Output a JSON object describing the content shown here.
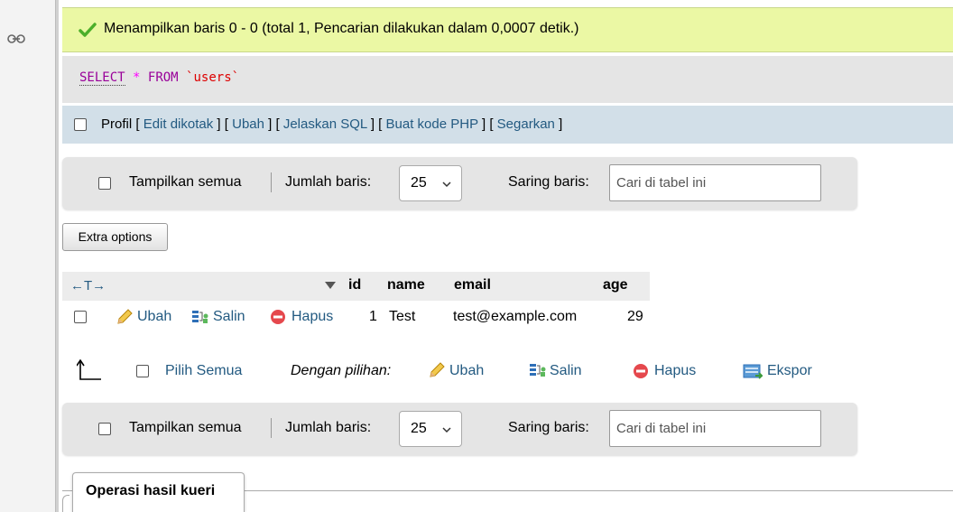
{
  "success": {
    "message": "Menampilkan baris 0 - 0 (total 1, Pencarian dilakukan dalam 0,0007 detik.)"
  },
  "sql": {
    "select": "SELECT",
    "star": "*",
    "from": "FROM",
    "table": "`users`"
  },
  "profile_bar": {
    "label": "Profil",
    "links": [
      "Edit dikotak",
      "Ubah",
      "Jelaskan SQL",
      "Buat kode PHP",
      "Segarkan"
    ]
  },
  "navigation": {
    "show_all": "Tampilkan semua",
    "rows_label": "Jumlah baris:",
    "rows_value": "25",
    "filter_label": "Saring baris:",
    "filter_placeholder": "Cari di tabel ini"
  },
  "extra_options": "Extra options",
  "table": {
    "arrows": "←T→",
    "columns": [
      "id",
      "name",
      "email",
      "age"
    ],
    "row_actions": {
      "edit": "Ubah",
      "copy": "Salin",
      "delete": "Hapus"
    },
    "rows": [
      {
        "id": "1",
        "name": "Test",
        "email": "test@example.com",
        "age": "29"
      }
    ]
  },
  "bulk": {
    "select_all": "Pilih Semua",
    "with_selected": "Dengan pilihan:",
    "edit": "Ubah",
    "copy": "Salin",
    "delete": "Hapus",
    "export": "Ekspor"
  },
  "operations_tab": "Operasi hasil kueri",
  "colors": {
    "success_bg": "#ebf8a4",
    "link": "#235a81",
    "sql_keyword": "#990099",
    "sql_table": "#dd0000",
    "profile_bg": "#d2dfe8"
  },
  "icons": {
    "success": "checkmark-icon",
    "edit": "pencil-icon",
    "copy": "copy-row-icon",
    "delete": "delete-icon",
    "export": "export-icon",
    "sort": "sort-desc-icon",
    "select_all_arrow": "arrow-up-icon",
    "gutter": "link-icon"
  }
}
